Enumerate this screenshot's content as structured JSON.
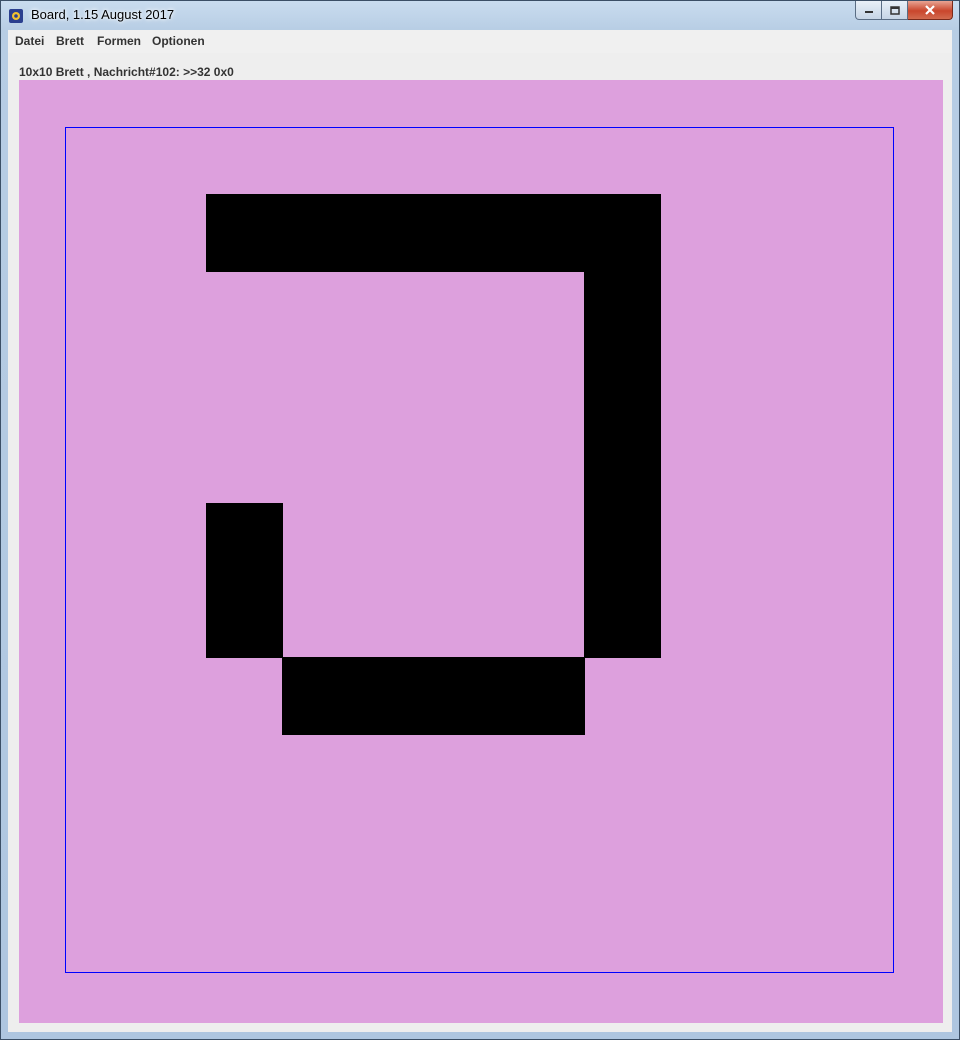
{
  "window": {
    "title": "Board, 1.15 August 2017",
    "app_icon": "board-app-icon",
    "controls": [
      "minimize-icon",
      "maximize-icon",
      "close-icon"
    ]
  },
  "menu": {
    "items": [
      {
        "label": "Datei"
      },
      {
        "label": "Brett"
      },
      {
        "label": "Formen"
      },
      {
        "label": "Optionen"
      }
    ]
  },
  "status": {
    "text": "10x10 Brett , Nachricht#102: >>32 0x0"
  },
  "board": {
    "rows": 10,
    "cols": 10,
    "background_color": "#dda0dd",
    "frame_color": "#0000ff",
    "cell_color": "#000000",
    "filled_cells": [
      [
        2,
        2
      ],
      [
        2,
        3
      ],
      [
        2,
        4
      ],
      [
        2,
        5
      ],
      [
        2,
        6
      ],
      [
        2,
        7
      ],
      [
        3,
        7
      ],
      [
        4,
        7
      ],
      [
        5,
        7
      ],
      [
        6,
        7
      ],
      [
        7,
        7
      ],
      [
        6,
        2
      ],
      [
        7,
        2
      ],
      [
        8,
        3
      ],
      [
        8,
        4
      ],
      [
        8,
        5
      ],
      [
        8,
        6
      ]
    ]
  }
}
